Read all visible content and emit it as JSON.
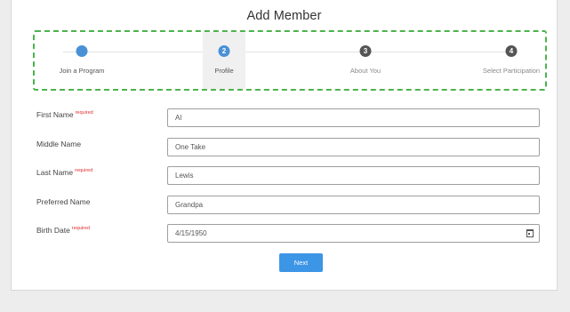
{
  "title": "Add Member",
  "steps": [
    {
      "number": "",
      "label": "Join a Program",
      "state": "done"
    },
    {
      "number": "2",
      "label": "Profile",
      "state": "current"
    },
    {
      "number": "3",
      "label": "About You",
      "state": "pending"
    },
    {
      "number": "4",
      "label": "Select Participation",
      "state": "pending"
    }
  ],
  "form": {
    "required_marker": "required",
    "fields": [
      {
        "label": "First Name",
        "value": "Al",
        "required": true
      },
      {
        "label": "Middle Name",
        "value": "One Take",
        "required": false
      },
      {
        "label": "Last Name",
        "value": "Lewis",
        "required": true
      },
      {
        "label": "Preferred Name",
        "value": "Grandpa",
        "required": false
      },
      {
        "label": "Birth Date",
        "value": "4/15/1950",
        "required": true
      }
    ]
  },
  "next_label": "Next",
  "icons": {
    "calendar": "calendar-icon"
  },
  "colors": {
    "accent": "#3d95e6",
    "step_border": "#4db34d",
    "required": "#e03030"
  }
}
